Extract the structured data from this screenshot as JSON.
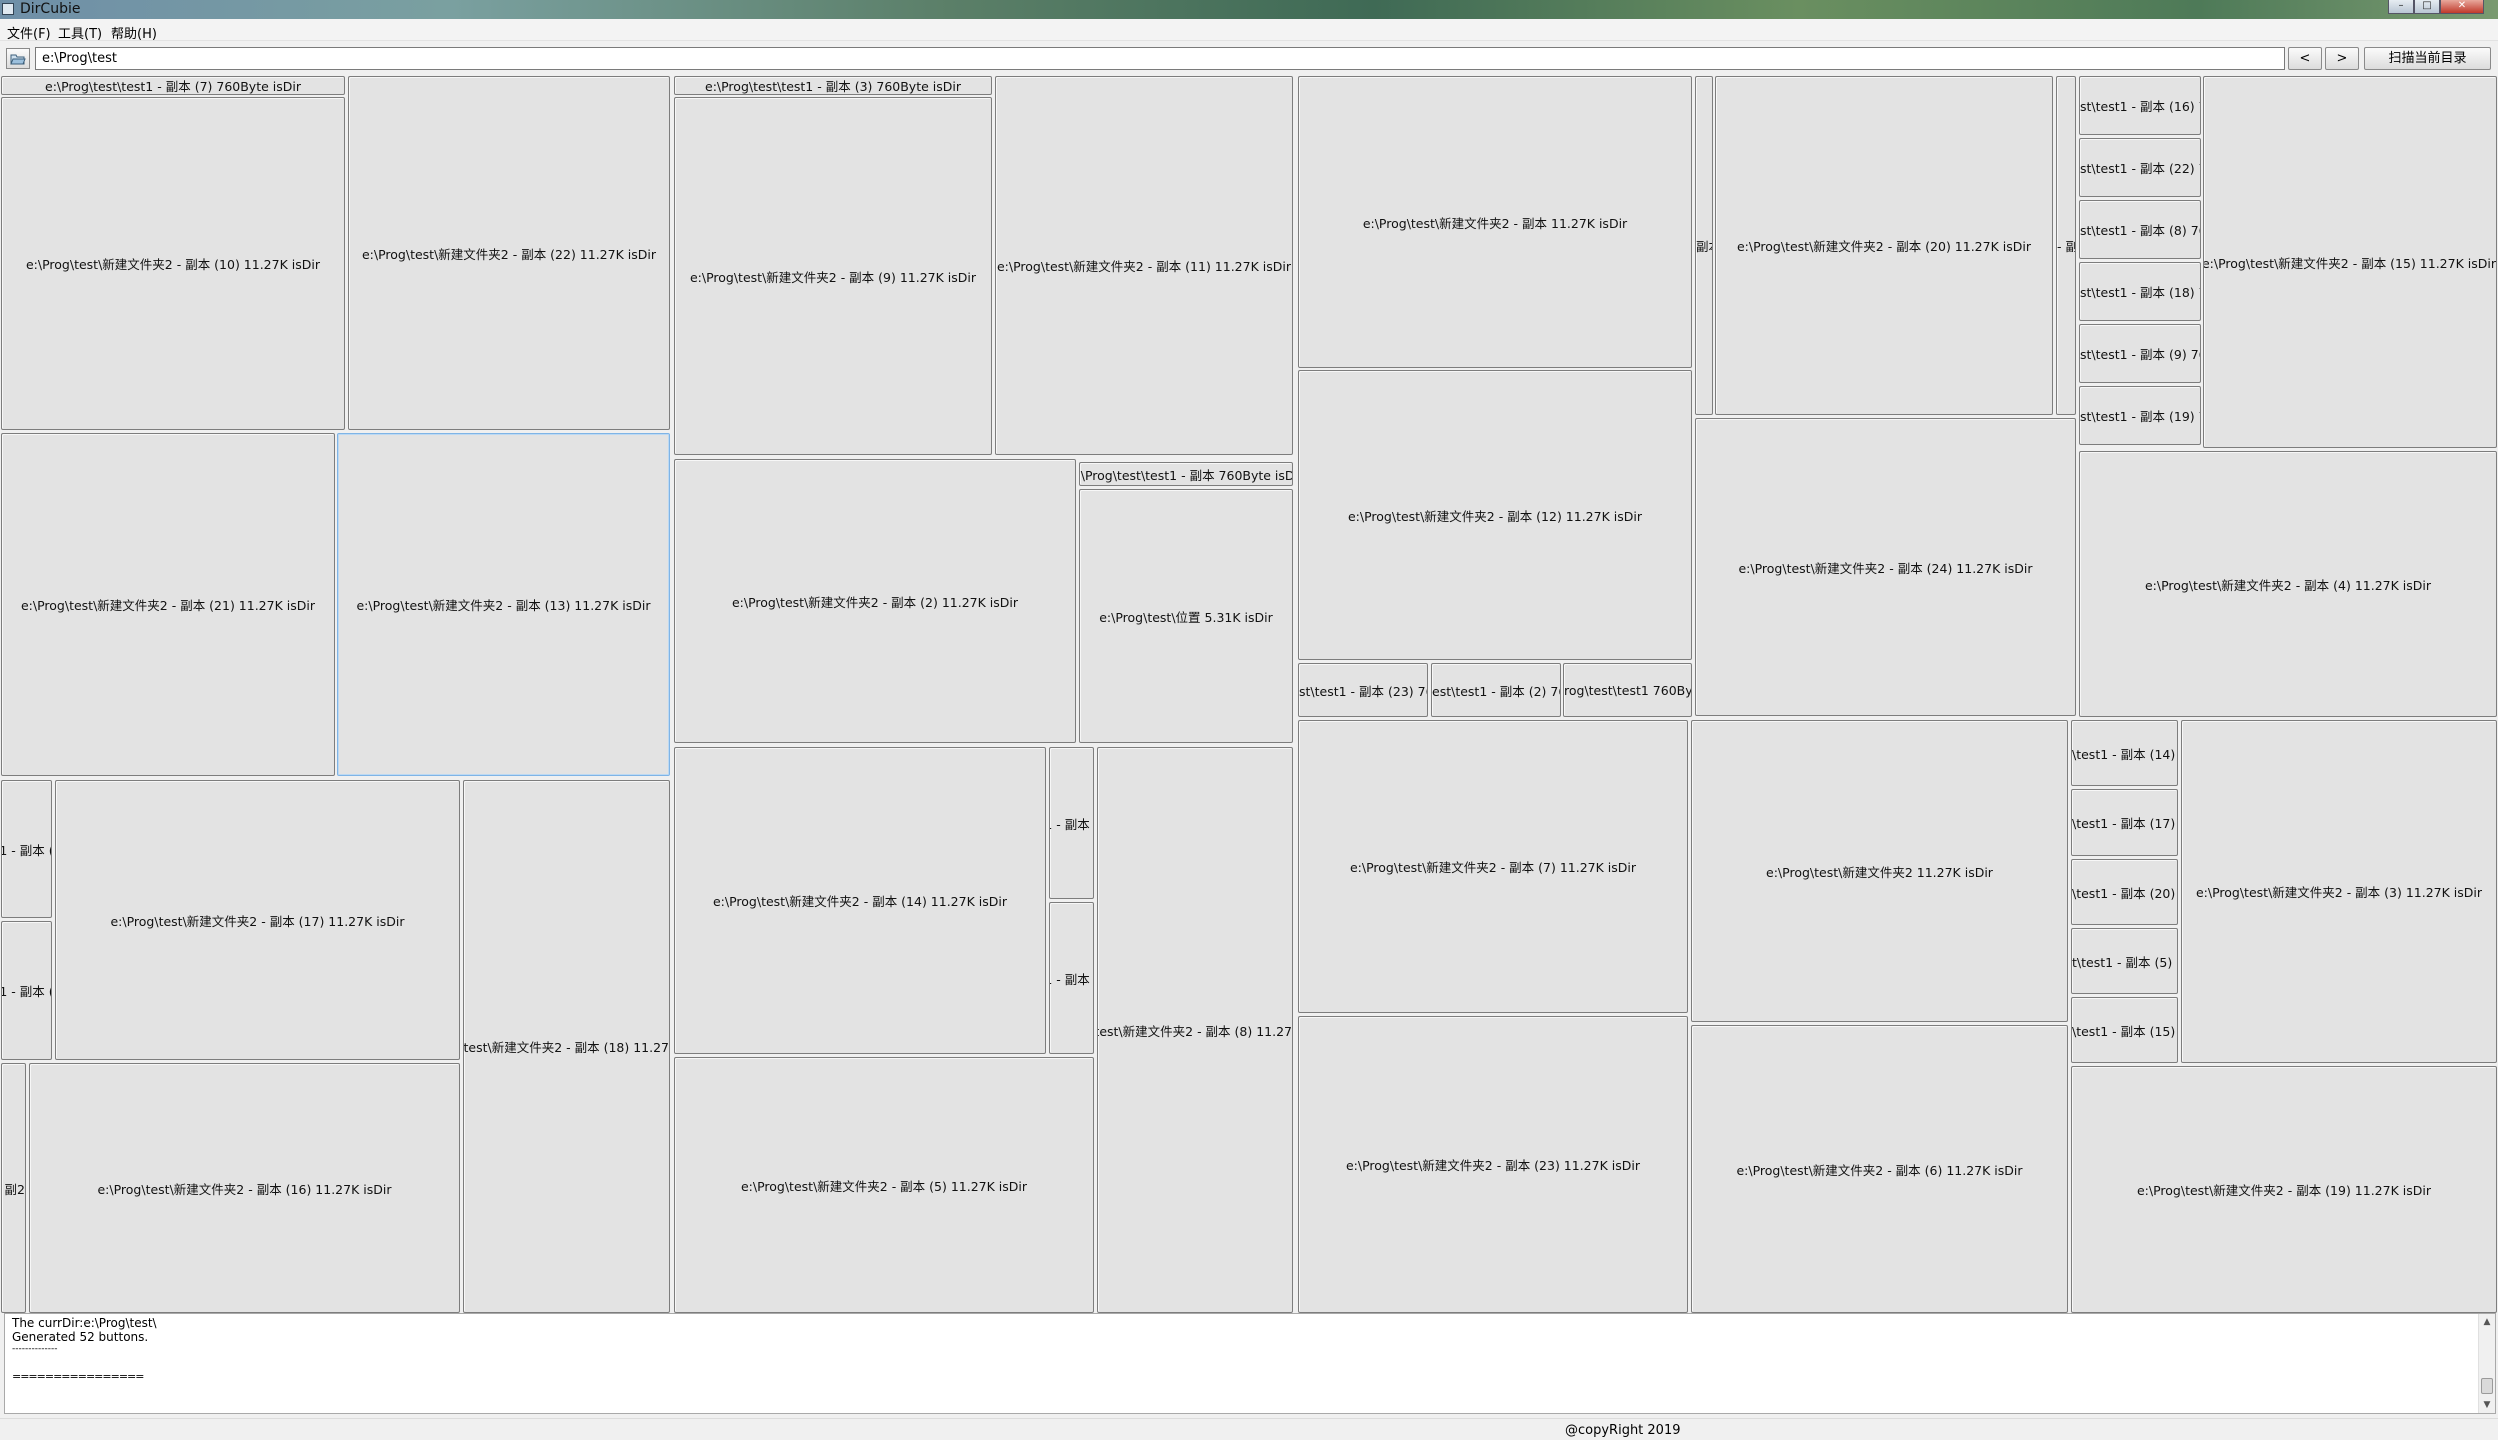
{
  "window": {
    "title": "DirCubie",
    "controls": {
      "minimize": "–",
      "maximize": "□",
      "close": "✕"
    }
  },
  "menu": {
    "file": "文件(F)",
    "tools": "工具(T)",
    "help": "帮助(H)"
  },
  "toolbar": {
    "path_value": "e:\\Prog\\test",
    "back_label": "<",
    "forward_label": ">",
    "scan_label": "扫描当前目录",
    "open_icon": "folder-open-icon"
  },
  "treemap": {
    "tiles": [
      {
        "label": "e:\\Prog\\test\\test1 - 副本 (7) 760Byte isDir"
      },
      {
        "label": "e:\\Prog\\test\\新建文件夹2 - 副本 (10) 11.27K isDir"
      },
      {
        "label": "e:\\Prog\\test\\新建文件夹2 - 副本 (22) 11.27K isDir"
      },
      {
        "label": "e:\\Prog\\test\\新建文件夹2 - 副本 (21) 11.27K isDir"
      },
      {
        "label": "e:\\Prog\\test\\新建文件夹2 - 副本 (13) 11.27K isDir"
      },
      {
        "label": "1 - 副本 ("
      },
      {
        "label": "1 - 副本 ("
      },
      {
        "label": "e:\\Prog\\test\\新建文件夹2 - 副本 (17) 11.27K isDir"
      },
      {
        "label": "g\\test\\新建文件夹2 - 副本 (18) 11.27"
      },
      {
        "label": "- 副2"
      },
      {
        "label": "e:\\Prog\\test\\新建文件夹2 - 副本 (16) 11.27K isDir"
      },
      {
        "label": "e:\\Prog\\test\\test1 - 副本 (3) 760Byte isDir"
      },
      {
        "label": "e:\\Prog\\test\\新建文件夹2 - 副本 (9) 11.27K isDir"
      },
      {
        "label": "e:\\Prog\\test\\新建文件夹2 - 副本 (11) 11.27K isDir"
      },
      {
        "label": "e:\\Prog\\test\\新建文件夹2 - 副本 (2) 11.27K isDir"
      },
      {
        "label": "e:\\Prog\\test\\test1 - 副本 760Byte isDir"
      },
      {
        "label": "e:\\Prog\\test\\位置 5.31K isDir"
      },
      {
        "label": "e:\\Prog\\test\\新建文件夹2 - 副本 (14) 11.27K isDir"
      },
      {
        "label": "1 - 副本 ("
      },
      {
        "label": "1 - 副本 ("
      },
      {
        "label": "g\\test\\新建文件夹2 - 副本 (8) 11.27"
      },
      {
        "label": "e:\\Prog\\test\\新建文件夹2 - 副本 (5) 11.27K isDir"
      },
      {
        "label": "e:\\Prog\\test\\新建文件夹2 - 副本 11.27K isDir"
      },
      {
        "label": "e:\\Prog\\test\\新建文件夹2 - 副本 (12) 11.27K isDir"
      },
      {
        "label": "st\\test1 - 副本 (23) 76"
      },
      {
        "label": "est\\test1 - 副本 (2) 760"
      },
      {
        "label": "rog\\test\\test1 760Byte"
      },
      {
        "label": "e:\\Prog\\test\\新建文件夹2 - 副本 (7) 11.27K isDir"
      },
      {
        "label": "e:\\Prog\\test\\新建文件夹2 - 副本 (23) 11.27K isDir"
      },
      {
        "label": "副本"
      },
      {
        "label": "e:\\Prog\\test\\新建文件夹2 - 副本 (20) 11.27K isDir"
      },
      {
        "label": "- 副"
      },
      {
        "label": "e:\\Prog\\test\\新建文件夹2 - 副本 (24) 11.27K isDir"
      },
      {
        "label": "e:\\Prog\\test\\新建文件夹2 11.27K isDir"
      },
      {
        "label": "e:\\Prog\\test\\新建文件夹2 - 副本 (6) 11.27K isDir"
      },
      {
        "label": "st\\test1 - 副本 (16) 76"
      },
      {
        "label": "st\\test1 - 副本 (22) 76"
      },
      {
        "label": "st\\test1 - 副本 (8) 76"
      },
      {
        "label": "st\\test1 - 副本 (18) 76"
      },
      {
        "label": "st\\test1 - 副本 (9) 76"
      },
      {
        "label": "st\\test1 - 副本 (19) 76"
      },
      {
        "label": "e:\\Prog\\test\\新建文件夹2 - 副本 (15) 11.27K isDir"
      },
      {
        "label": "e:\\Prog\\test\\新建文件夹2 - 副本 (4) 11.27K isDir"
      },
      {
        "label": "\\test1 - 副本 (14) 7"
      },
      {
        "label": "\\test1 - 副本 (17) 7"
      },
      {
        "label": "\\test1 - 副本 (20) 7"
      },
      {
        "label": "t\\test1 - 副本 (5) 76"
      },
      {
        "label": "\\test1 - 副本 (15) 7"
      },
      {
        "label": "e:\\Prog\\test\\新建文件夹2 - 副本 (3) 11.27K isDir"
      },
      {
        "label": "e:\\Prog\\test\\新建文件夹2 - 副本 (19) 11.27K isDir"
      }
    ]
  },
  "log": {
    "lines": [
      "The currDir:e:\\Prog\\test\\",
      "Generated 52 buttons.",
      "--------------",
      "",
      "================"
    ]
  },
  "status": {
    "copyright": "@copyRight 2019"
  }
}
